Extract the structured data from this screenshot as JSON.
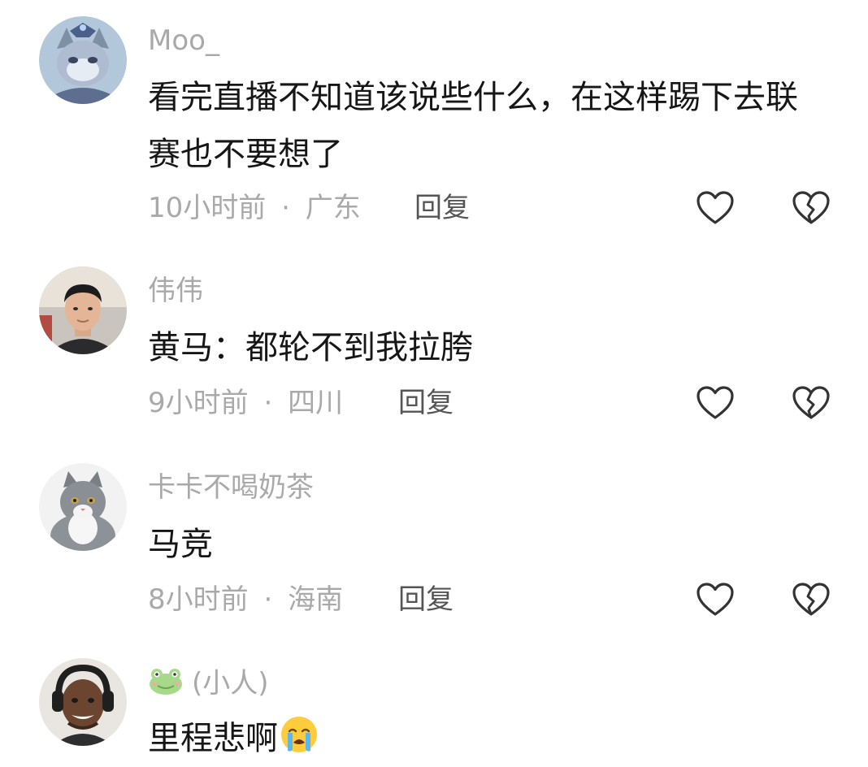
{
  "comments": [
    {
      "username": "Moo_",
      "content": "看完直播不知道该说些什么，在这样踢下去联赛也不要想了",
      "time": "10小时前",
      "separator": "·",
      "location": "广东",
      "reply_label": "回复",
      "avatar_icon": "cat-mage-avatar"
    },
    {
      "username": "伟伟",
      "content": "黄马：都轮不到我拉胯",
      "time": "9小时前",
      "separator": "·",
      "location": "四川",
      "reply_label": "回复",
      "avatar_icon": "man-photo-avatar"
    },
    {
      "username": "卡卡不喝奶茶",
      "content": "马竞",
      "time": "8小时前",
      "separator": "·",
      "location": "海南",
      "reply_label": "回复",
      "avatar_icon": "british-shorthair-cat-avatar"
    },
    {
      "username": "(小人)",
      "username_icon": "frog-icon",
      "content": "里程悲啊",
      "content_emoji": "crying-face-emoji",
      "avatar_icon": "man-headphones-avatar"
    }
  ],
  "icons": {
    "like": "heart-outline-icon",
    "dislike": "broken-heart-icon"
  },
  "colors": {
    "meta_text": "#a9a9a9",
    "reply_text": "#555555",
    "content_text": "#161616",
    "icon_stroke": "#333333"
  }
}
